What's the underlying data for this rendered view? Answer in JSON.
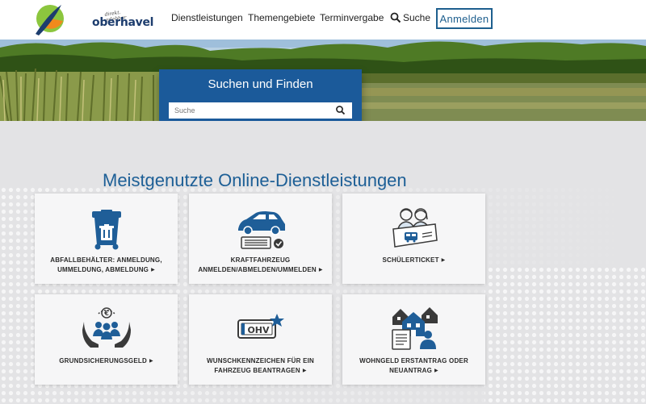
{
  "header": {
    "logo_tagline": "direkt. erlebbar",
    "logo_text": "oberhavel",
    "nav": {
      "services": "Dienstleistungen",
      "topics": "Themengebiete",
      "appointments": "Terminvergabe",
      "search": "Suche"
    },
    "login_label": "Anmelden"
  },
  "hero": {
    "search_title": "Suchen und Finden",
    "search_placeholder": "Suche"
  },
  "main": {
    "section_title": "Meistgenutzte Online-Dienstleistungen",
    "cards": [
      {
        "label_line1": "Abfallbehälter: Anmeldung,",
        "label_line2": "Ummeldung, Abmeldung",
        "icon": "waste-bin-icon"
      },
      {
        "label_line1": "Kraftfahrzeug",
        "label_line2": "anmelden/abmelden/ummelden",
        "icon": "car-icon"
      },
      {
        "label_line1": "",
        "label_line2": "Schülerticket",
        "icon": "student-ticket-icon"
      },
      {
        "label_line1": "",
        "label_line2": "Grundsicherungsgeld",
        "icon": "basic-income-icon"
      },
      {
        "label_line1": "Wunschkennzeichen für ein",
        "label_line2": "Fahrzeug beantragen",
        "icon": "license-plate-icon"
      },
      {
        "label_line1": "Wohngeld Erstantrag oder",
        "label_line2": "Neuantrag",
        "icon": "housing-benefit-icon"
      }
    ],
    "plate_text": "OHV"
  },
  "colors": {
    "brand_blue": "#1d5f96",
    "search_box": "#1b5a9a",
    "icon_blue": "#1f5e98",
    "icon_gray": "#3a3a3a"
  }
}
